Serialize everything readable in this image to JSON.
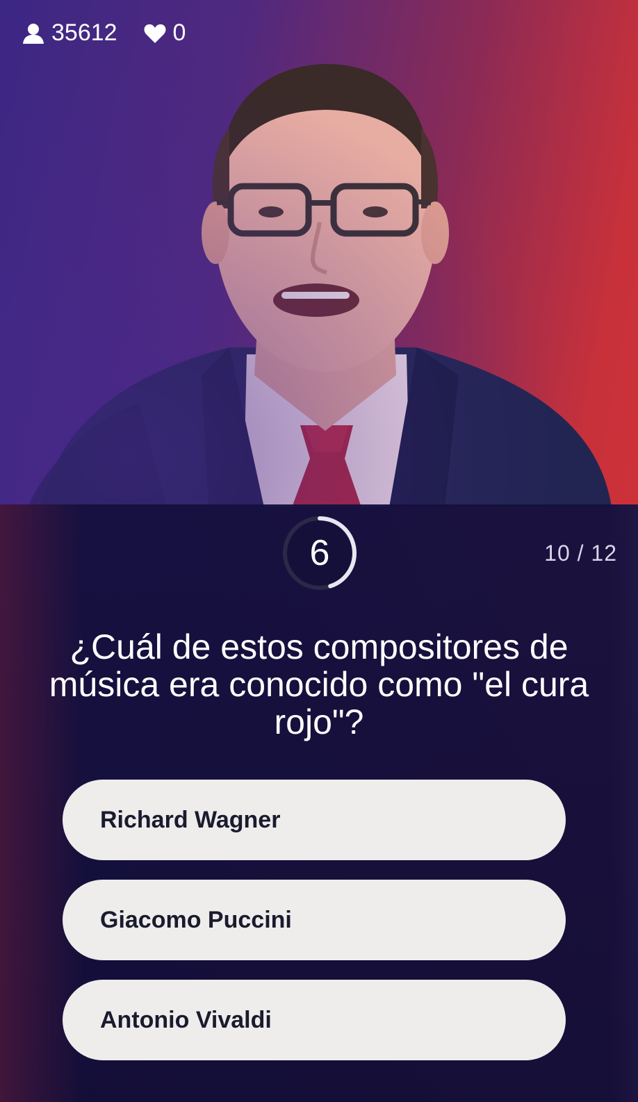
{
  "stats": {
    "viewers": "35612",
    "viewers_icon": "person-icon",
    "hearts": "0",
    "hearts_icon": "heart-icon"
  },
  "timer": {
    "seconds": "6",
    "remaining_fraction": 0.45
  },
  "progress": "10 / 12",
  "question": "¿Cuál de estos compositores de música era conocido como \"el cura rojo\"?",
  "answers": [
    {
      "label": "Richard Wagner"
    },
    {
      "label": "Giacomo Puccini"
    },
    {
      "label": "Antonio Vivaldi"
    }
  ],
  "colors": {
    "bg_left": "#3c2784",
    "bg_right": "#d63236",
    "panel": "#140f3e",
    "answer_bg": "#eeedeb",
    "answer_text": "#1a1b2e"
  }
}
